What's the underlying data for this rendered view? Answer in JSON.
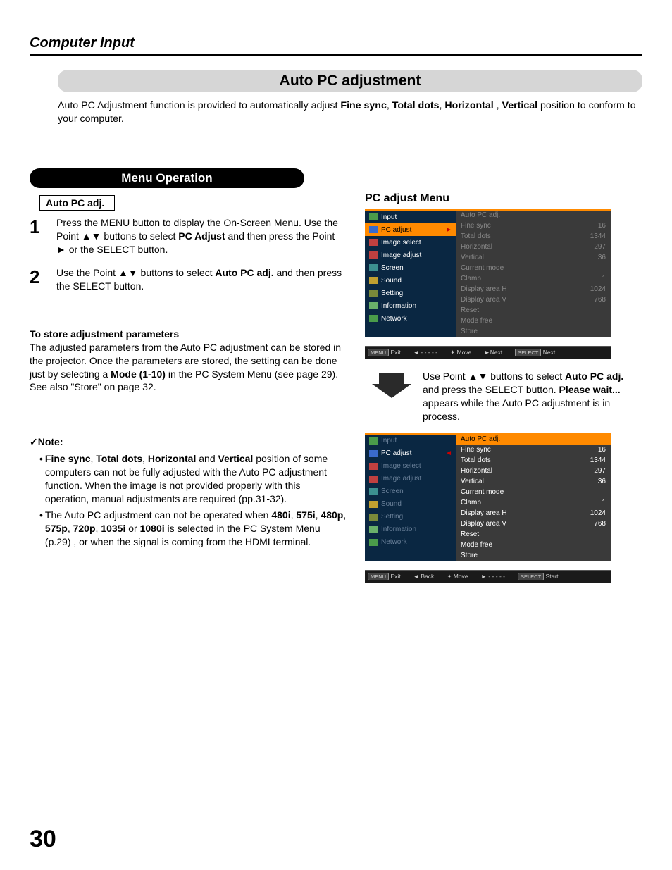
{
  "header": "Computer Input",
  "title": "Auto PC adjustment",
  "intro_pre": "Auto PC Adjustment function is provided to automatically adjust ",
  "intro_b1": "Fine sync",
  "intro_b2": "Total dots",
  "intro_b3": "Horizontal",
  "intro_b4": "Vertical",
  "intro_post": " position to conform to your computer.",
  "menu_op": "Menu Operation",
  "auto_pc_adj": "Auto PC adj.",
  "step1_num": "1",
  "step1_a": "Press the MENU button to display the On-Screen Menu. Use the Point ▲▼ buttons to select ",
  "step1_b": "PC Adjust",
  "step1_c": " and then press the Point ► or the SELECT button.",
  "step2_num": "2",
  "step2_a": "Use the Point ▲▼ buttons to select ",
  "step2_b": "Auto PC adj.",
  "step2_c": " and then press the SELECT button.",
  "store_head": "To store adjustment parameters",
  "store_a": "The adjusted parameters from the Auto PC adjustment can be stored in the projector. Once the parameters are stored, the setting can be done just by selecting a ",
  "store_b": "Mode (1-10)",
  "store_c": " in the PC System Menu (see page 29). See also \"Store\" on page 32.",
  "note_head": "Note:",
  "note1_a": "Fine sync",
  "note1_b": "Total dots",
  "note1_c": "Horizontal",
  "note1_d": "Vertical",
  "note1_e": " position of some computers can not be fully adjusted with the Auto PC adjustment function. When the image is not provided properly with this operation, manual adjustments are required (pp.31-32).",
  "note2_a": "The Auto PC adjustment can not be operated when ",
  "note2_b1": "480i",
  "note2_b2": "575i",
  "note2_b3": "480p",
  "note2_b4": "575p",
  "note2_b5": "720p",
  "note2_b6": "1035i",
  "note2_b7": "1080i",
  "note2_c": " is selected in the PC System Menu (p.29) , or when the signal is coming from the HDMI terminal.",
  "pc_menu_head": "PC adjust Menu",
  "arrow_a": "Use Point ▲▼ buttons to select ",
  "arrow_b": "Auto PC adj.",
  "arrow_c": " and press the SELECT button. ",
  "arrow_d": "Please wait...",
  "arrow_e": " appears while the Auto PC adjustment is in process.",
  "osd": {
    "left": [
      "Input",
      "PC adjust",
      "Image select",
      "Image adjust",
      "Screen",
      "Sound",
      "Setting",
      "Information",
      "Network"
    ],
    "right": [
      {
        "l": "Auto PC adj.",
        "v": ""
      },
      {
        "l": "Fine sync",
        "v": "16"
      },
      {
        "l": "Total dots",
        "v": "1344"
      },
      {
        "l": "Horizontal",
        "v": "297"
      },
      {
        "l": "Vertical",
        "v": "36"
      },
      {
        "l": "Current mode",
        "v": ""
      },
      {
        "l": "Clamp",
        "v": "1"
      },
      {
        "l": "Display area H",
        "v": "1024"
      },
      {
        "l": "Display area V",
        "v": "768"
      },
      {
        "l": "Reset",
        "v": ""
      },
      {
        "l": "Mode free",
        "v": ""
      },
      {
        "l": "Store",
        "v": ""
      }
    ],
    "foot1": {
      "exit": "Exit",
      "back": "◄ - - - - -",
      "move": "✦ Move",
      "next": "►Next",
      "sel": "Next"
    },
    "foot2": {
      "exit": "Exit",
      "back": "◄ Back",
      "move": "✦ Move",
      "next": "► - - - - -",
      "sel": "Start"
    }
  },
  "page_num": "30"
}
